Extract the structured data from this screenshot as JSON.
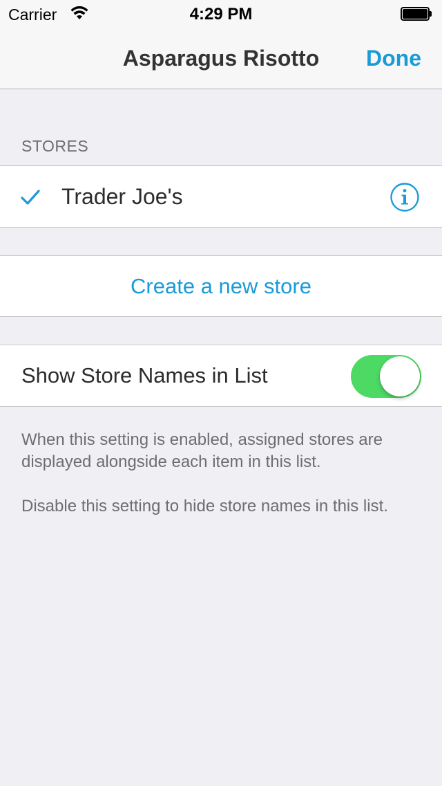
{
  "status_bar": {
    "carrier": "Carrier",
    "time": "4:29 PM",
    "wifi_icon": "wifi-icon",
    "battery_icon": "battery-full-icon"
  },
  "nav": {
    "title": "Asparagus Risotto",
    "done_label": "Done"
  },
  "stores_section": {
    "header": "STORES",
    "items": [
      {
        "name": "Trader Joe's",
        "checked": true,
        "check_icon": "checkmark-icon",
        "info_icon": "info-icon"
      }
    ]
  },
  "create_store": {
    "label": "Create a new store"
  },
  "settings": {
    "show_store_names_label": "Show Store Names in List",
    "show_store_names_on": true,
    "footer_line_1": "When this setting is enabled, assigned stores are displayed alongside each item in this list.",
    "footer_line_2": "Disable this setting to hide store names in this list."
  },
  "colors": {
    "accent": "#1a9bd7",
    "switch_on": "#4cd964",
    "background": "#efeff4"
  }
}
